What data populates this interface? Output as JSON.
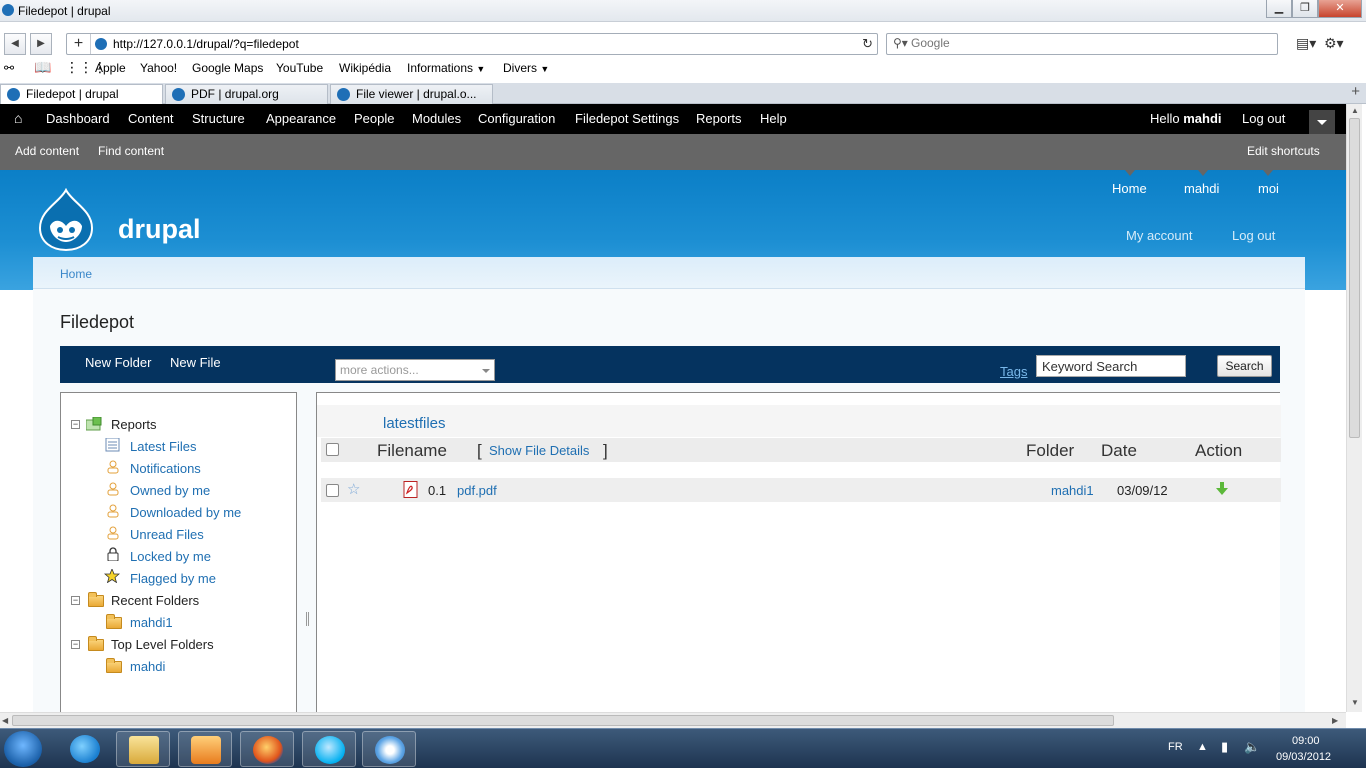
{
  "browser": {
    "window_title": "Filedepot | drupal",
    "url": "http://127.0.0.1/drupal/?q=filedepot",
    "search_placeholder": "Google",
    "bookmarks": [
      "Apple",
      "Yahoo!",
      "Google Maps",
      "YouTube",
      "Wikipédia",
      "Informations",
      "Divers"
    ],
    "tabs": [
      "Filedepot | drupal",
      "PDF | drupal.org",
      "File viewer | drupal.o..."
    ]
  },
  "admin_toolbar": {
    "items": [
      "Dashboard",
      "Content",
      "Structure",
      "Appearance",
      "People",
      "Modules",
      "Configuration",
      "Filedepot Settings",
      "Reports",
      "Help"
    ],
    "hello": "Hello",
    "username": "mahdi",
    "logout": "Log out",
    "shortcuts": [
      "Add content",
      "Find content"
    ],
    "edit_shortcuts": "Edit shortcuts"
  },
  "header": {
    "site_name": "drupal",
    "menu": [
      "Home",
      "mahdi",
      "moi"
    ],
    "my_account": "My account",
    "logout": "Log out"
  },
  "breadcrumb": "Home",
  "page_title": "Filedepot",
  "filedepot": {
    "new_folder": "New Folder",
    "new_file": "New File",
    "more_actions": "more actions...",
    "tags": "Tags",
    "keyword_search": "Keyword Search",
    "search_button": "Search",
    "tree": {
      "reports": "Reports",
      "report_items": [
        "Latest Files",
        "Notifications",
        "Owned by me",
        "Downloaded by me",
        "Unread Files",
        "Locked by me",
        "Flagged by me"
      ],
      "recent_folders": "Recent Folders",
      "recent_items": [
        "mahdi1"
      ],
      "top_level_folders": "Top Level Folders",
      "top_items": [
        "mahdi"
      ]
    },
    "listing": {
      "section_title": "latestfiles",
      "columns": {
        "filename": "Filename",
        "folder": "Folder",
        "date": "Date",
        "action": "Action"
      },
      "bracket_open": "[",
      "show_details": "Show File Details",
      "bracket_close": "]",
      "rows": [
        {
          "version": "0.1",
          "filename": "pdf.pdf",
          "folder": "mahdi1",
          "date": "03/09/12"
        }
      ]
    }
  },
  "taskbar": {
    "language": "FR",
    "time": "09:00",
    "date": "09/03/2012"
  },
  "colors": {
    "admin_toolbar": "#000000",
    "shortcut_bar": "#666666",
    "header_blue": "#1d8fd3",
    "filedepot_bar": "#05335f",
    "link": "#1f6fb2"
  }
}
